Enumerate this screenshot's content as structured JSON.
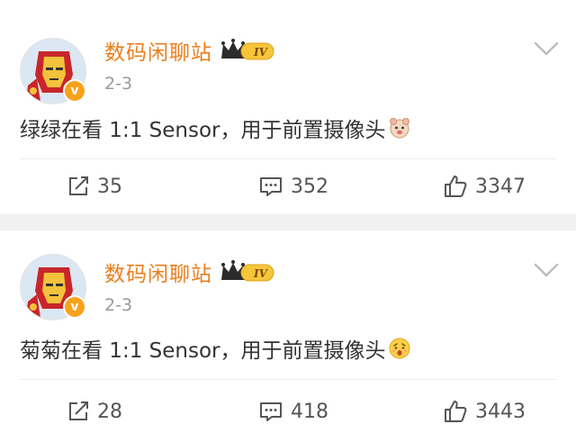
{
  "posts": [
    {
      "username": "数码闲聊站",
      "date": "2-3",
      "level_badge": "IV",
      "content": "绿绿在看 1:1 Sensor，用于前置摄像头",
      "emoji_icon": "hamster-emoji-icon",
      "reposts": "35",
      "comments": "352",
      "likes": "3347"
    },
    {
      "username": "数码闲聊站",
      "date": "2-3",
      "level_badge": "IV",
      "content": "菊菊在看 1:1 Sensor，用于前置摄像头",
      "emoji_icon": "surprised-face-emoji-icon",
      "reposts": "28",
      "comments": "418",
      "likes": "3443"
    }
  ],
  "colors": {
    "username": "#ec7e1c",
    "verified_badge": "#f7a21b",
    "date": "#999999",
    "text": "#333333",
    "background": "#f1f1f1"
  }
}
